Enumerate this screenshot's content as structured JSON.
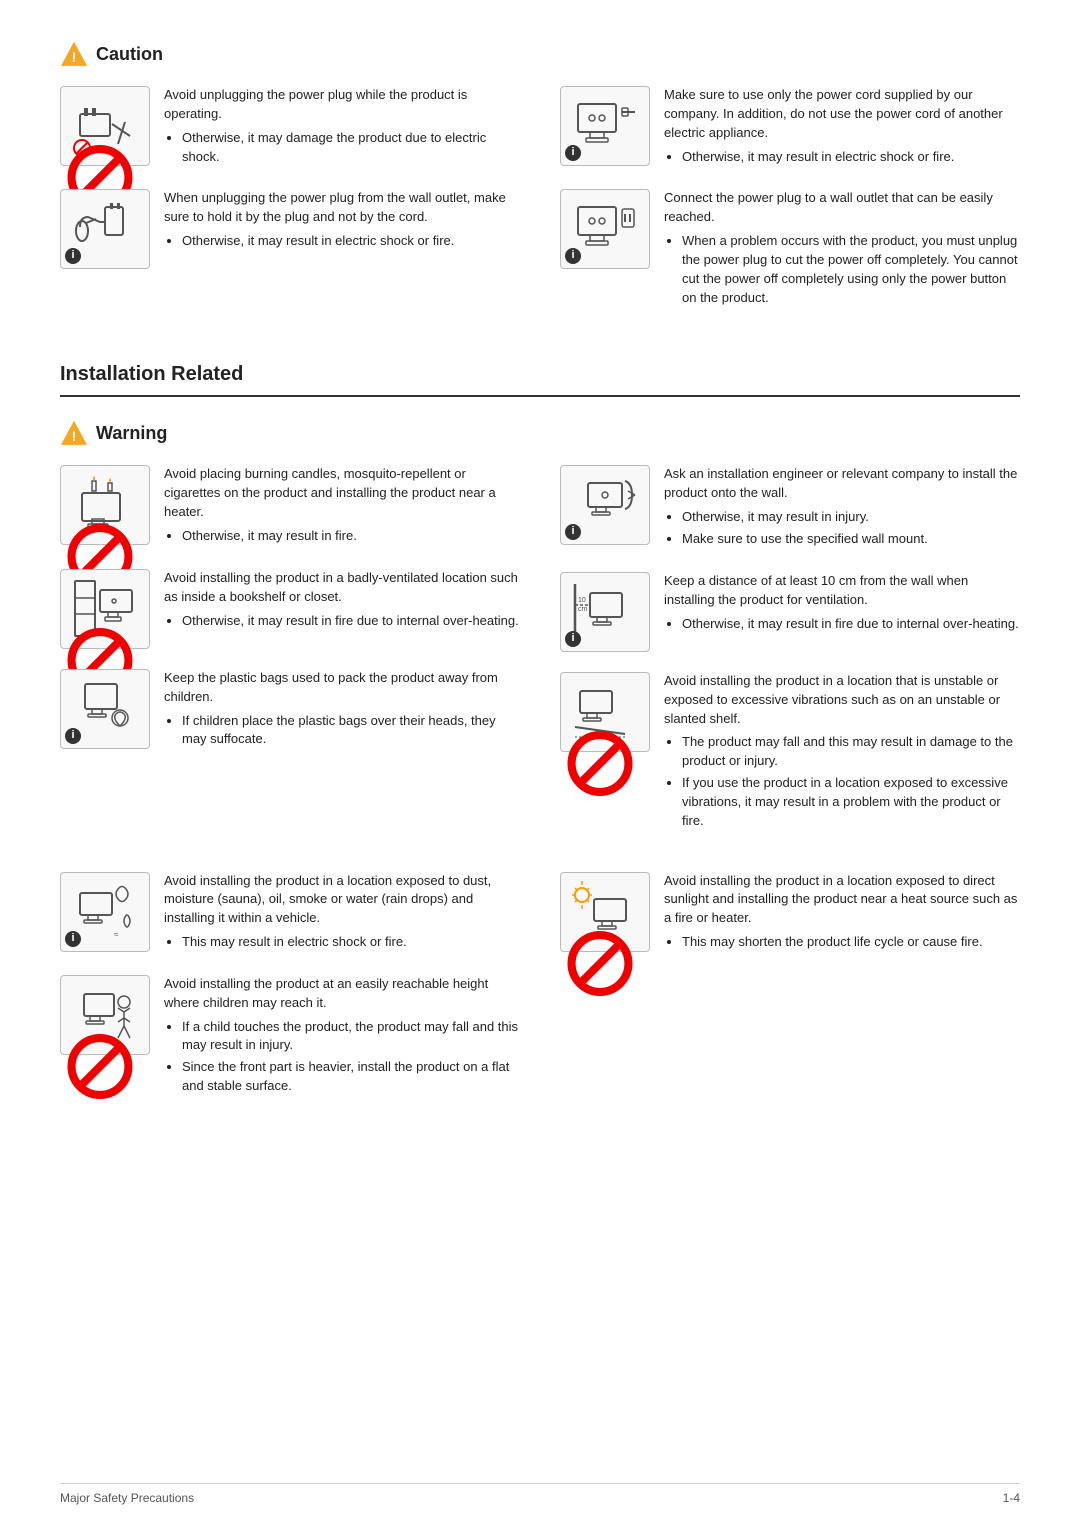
{
  "caution": {
    "heading": "Caution",
    "col1": [
      {
        "id": "caution-1",
        "main_text": "Avoid unplugging the power plug while the product is operating.",
        "bullets": [
          "Otherwise, it may damage the product due to electric shock."
        ],
        "icon_type": "plug_x",
        "symbol": "no"
      },
      {
        "id": "caution-2",
        "main_text": "When unplugging the power plug from the wall outlet, make sure to hold it by the plug and not by the cord.",
        "bullets": [
          "Otherwise, it may result in electric shock or fire."
        ],
        "icon_type": "unplug_hand",
        "symbol": "info"
      }
    ],
    "col2": [
      {
        "id": "caution-3",
        "main_text": "Make sure to use only the power cord supplied by our company. In addition, do not use the power cord of another electric appliance.",
        "bullets": [
          "Otherwise, it may result in electric shock or fire."
        ],
        "icon_type": "monitor_plug",
        "symbol": "info"
      },
      {
        "id": "caution-4",
        "main_text": "Connect the power plug to a wall outlet that can be easily reached.",
        "bullets": [
          "When a problem occurs with the product, you must unplug the power plug to cut the power off completely. You cannot cut the power off completely using only the power button on the product."
        ],
        "icon_type": "wall_outlet",
        "symbol": "info"
      }
    ]
  },
  "installation_related": {
    "heading": "Installation Related"
  },
  "warning": {
    "heading": "Warning",
    "col1": [
      {
        "id": "warn-1",
        "main_text": "Avoid placing burning candles,  mosquito-repellent or cigarettes on the product and installing the product near a heater.",
        "bullets": [
          "Otherwise, it may result in fire."
        ],
        "icon_type": "candles_monitor",
        "symbol": "no"
      },
      {
        "id": "warn-2",
        "main_text": "Avoid installing the product in a badly-ventilated location such as inside a bookshelf or closet.",
        "bullets": [
          "Otherwise, it may result in fire due to internal over-heating."
        ],
        "icon_type": "bookshelf_monitor",
        "symbol": "no"
      },
      {
        "id": "warn-3",
        "main_text": "Keep the plastic bags used to pack the product away from children.",
        "bullets": [
          "If children place the plastic bags over their heads, they may suffocate."
        ],
        "icon_type": "child_bag",
        "symbol": "info"
      }
    ],
    "col2": [
      {
        "id": "warn-4",
        "main_text": "Ask an installation engineer or relevant company to install the product onto the wall.",
        "bullets": [
          "Otherwise, it may result in injury.",
          "Make sure to use the specified wall mount."
        ],
        "icon_type": "wall_mount",
        "symbol": "info"
      },
      {
        "id": "warn-5",
        "main_text": "Keep a distance of at least 10 cm from the wall when installing the product for ventilation.",
        "bullets": [
          "Otherwise, it may result in fire due to internal over-heating."
        ],
        "icon_type": "wall_distance",
        "symbol": "info"
      },
      {
        "id": "warn-6",
        "main_text": "Avoid installing the product in a location that is unstable or exposed to excessive vibrations such as on an unstable or slanted shelf.",
        "bullets": [
          "The product may fall and this may result in damage to the product or injury.",
          "If you use the product in a location exposed to excessive vibrations, it may result in a problem with the product or fire."
        ],
        "icon_type": "unstable_shelf",
        "symbol": "no"
      }
    ],
    "col1_bottom": [
      {
        "id": "warn-7",
        "main_text": "Avoid installing the product in a location exposed to dust, moisture (sauna), oil, smoke or water (rain drops) and installing it within a vehicle.",
        "bullets": [
          "This may result in electric shock or fire."
        ],
        "icon_type": "dust_moisture",
        "symbol": "info"
      },
      {
        "id": "warn-8",
        "main_text": "Avoid installing the product at an easily reachable height where children may reach it.",
        "bullets": [
          "If a child touches the product, the product may fall and this may result in injury.",
          "Since the front part is heavier, install the product on a flat and stable surface."
        ],
        "icon_type": "child_reach",
        "symbol": "no"
      }
    ],
    "col2_bottom": [
      {
        "id": "warn-9",
        "main_text": "Avoid installing the product in a location exposed to direct sunlight and installing the product near a heat source such as a fire or heater.",
        "bullets": [
          "This may shorten the product life cycle or cause fire."
        ],
        "icon_type": "sunlight_monitor",
        "symbol": "no"
      }
    ]
  },
  "footer": {
    "left": "Major Safety Precautions",
    "right": "1-4"
  }
}
